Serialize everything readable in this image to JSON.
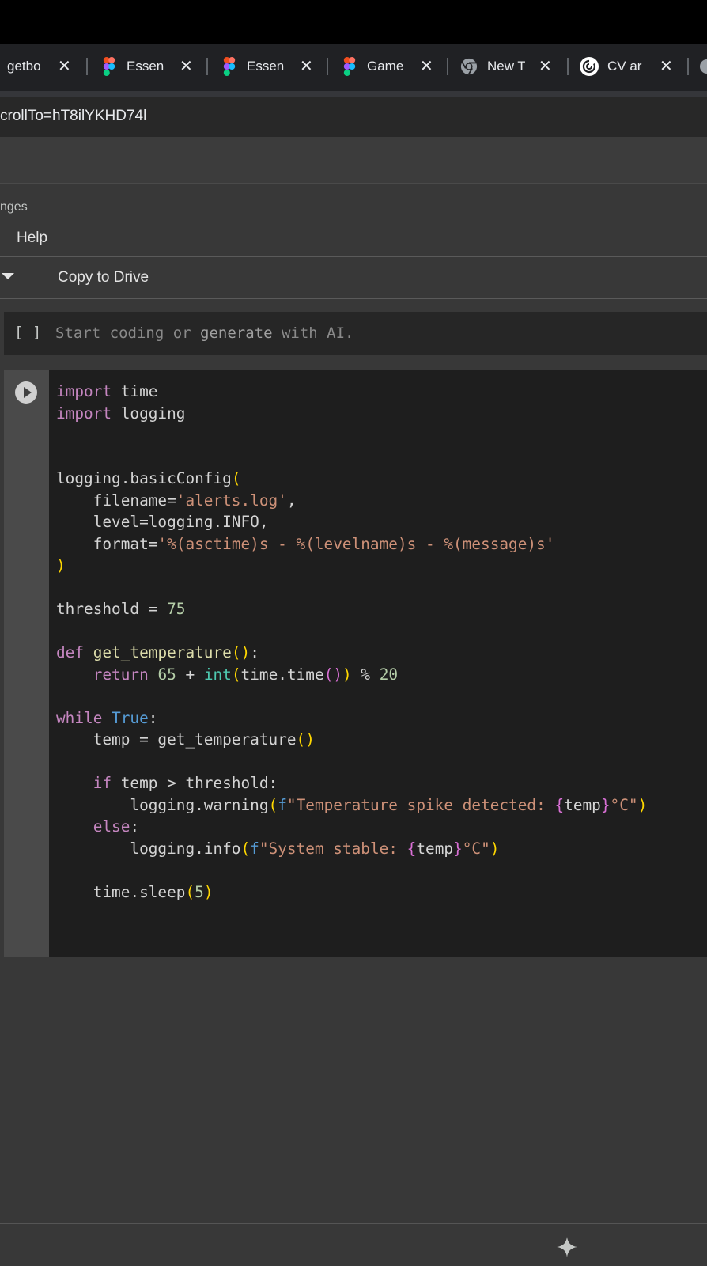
{
  "browser": {
    "tabs": [
      {
        "title": "getbo",
        "icon": "generic-favicon"
      },
      {
        "title": "Essen",
        "icon": "figma-icon"
      },
      {
        "title": "Essen",
        "icon": "figma-icon"
      },
      {
        "title": "Game",
        "icon": "figma-icon"
      },
      {
        "title": "New T",
        "icon": "chrome-icon"
      },
      {
        "title": "CV ar",
        "icon": "chatgpt-icon"
      }
    ],
    "close_glyph": "✕",
    "url": "crollTo=hT8ilYKHD74l"
  },
  "menu": {
    "changes_label": "nges",
    "help_label": "Help"
  },
  "toolbar": {
    "copy_to_drive_label": "Copy to Drive"
  },
  "empty_cell": {
    "brackets": "[ ]",
    "placeholder_start": "Start coding or ",
    "placeholder_link": "generate",
    "placeholder_end": " with AI."
  },
  "code_cell": {
    "language": "python",
    "source": "import time\nimport logging\n\n\nlogging.basicConfig(\n    filename='alerts.log',\n    level=logging.INFO,\n    format='%(asctime)s - %(levelname)s - %(message)s'\n)\n\nthreshold = 75\n\ndef get_temperature():\n    return 65 + int(time.time()) % 20\n\nwhile True:\n    temp = get_temperature()\n\n    if temp > threshold:\n        logging.warning(f\"Temperature spike detected: {temp}°C\")\n    else:\n        logging.info(f\"System stable: {temp}°C\")\n\n    time.sleep(5)"
  },
  "icons": {
    "run": "play-circle-icon",
    "dropdown": "caret-down-icon",
    "gemini": "sparkle-icon"
  },
  "colors": {
    "keyword": "#c586c0",
    "builtin_const": "#569cd6",
    "function": "#dcdcaa",
    "string": "#ce9178",
    "number": "#b5cea8",
    "paren": "#ffd700"
  }
}
